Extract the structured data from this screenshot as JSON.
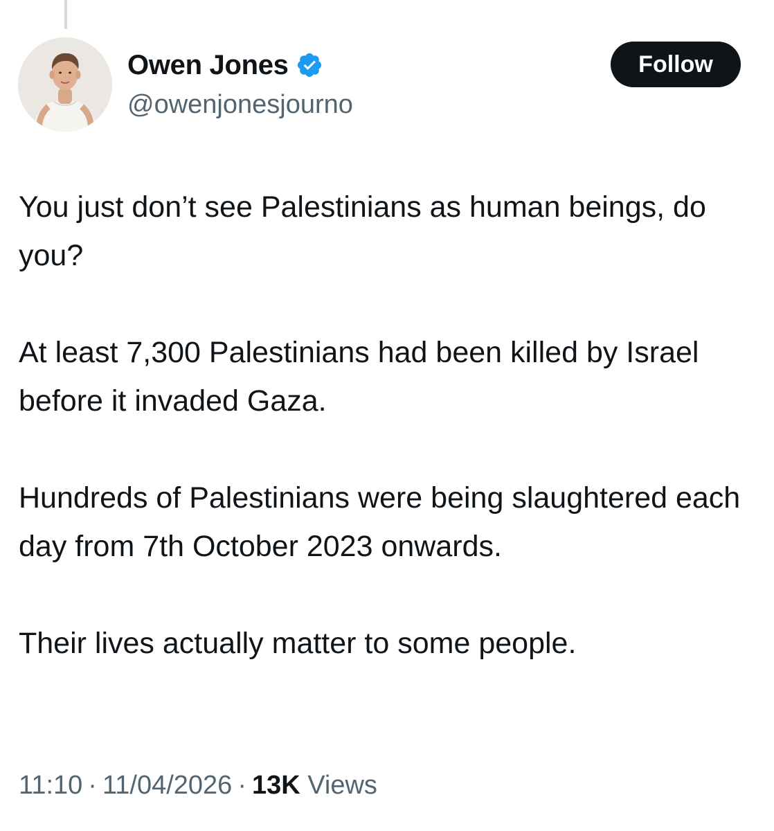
{
  "author": {
    "display_name": "Owen Jones",
    "handle": "@owenjonesjourno",
    "verified": true,
    "verified_icon": "verified-badge-icon",
    "verified_color": "#1d9bf0"
  },
  "actions": {
    "follow_label": "Follow"
  },
  "tweet": {
    "paragraphs": [
      "You just don’t see Palestinians as human beings, do you?",
      "At least 7,300 Palestinians had been killed by Israel before it invaded Gaza.",
      "Hundreds of Palestinians were being slaughtered each day from 7th October 2023 onwards.",
      "Their lives actually matter to some people."
    ]
  },
  "meta": {
    "time": "11:10",
    "separator": "·",
    "date": "11/04/2026",
    "views_count": "13K",
    "views_label": "Views"
  },
  "colors": {
    "text_primary": "#0f1419",
    "text_secondary": "#536471",
    "button_bg": "#0f1419",
    "button_text": "#ffffff",
    "thread_line": "#cfd9de"
  }
}
